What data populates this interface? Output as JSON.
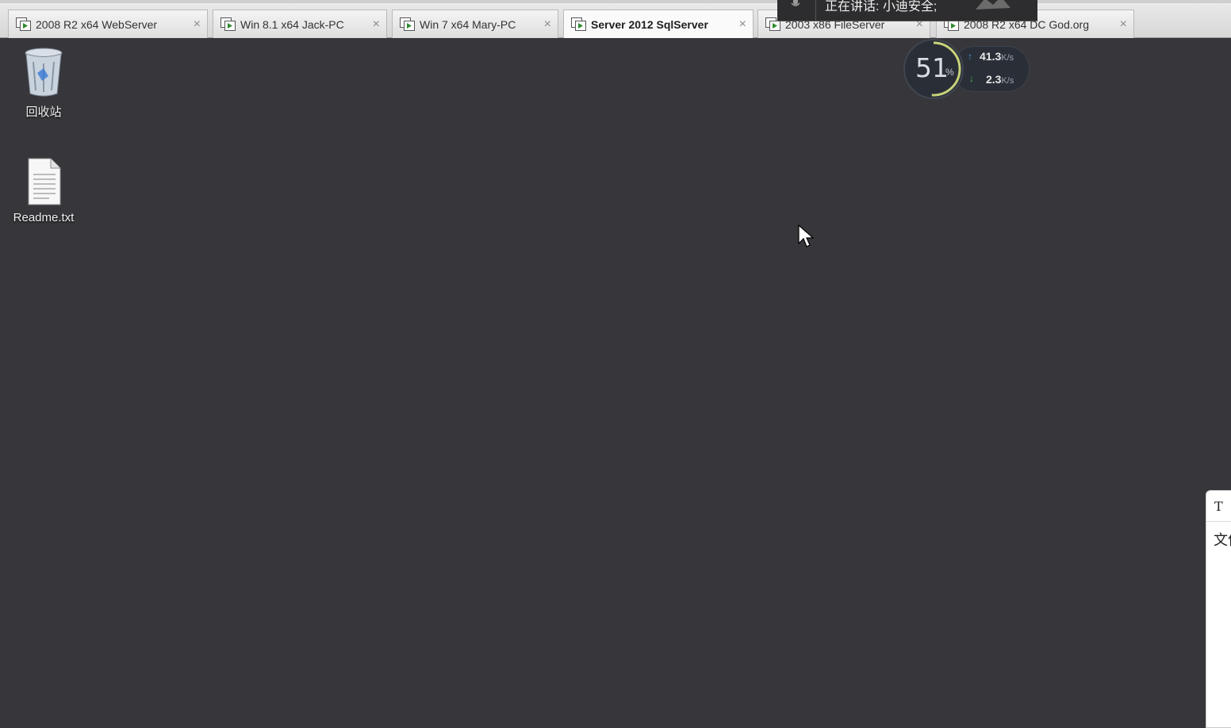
{
  "tabs": [
    {
      "label": "2008 R2 x64 WebServer",
      "active": false
    },
    {
      "label": "Win 8.1 x64 Jack-PC",
      "active": false
    },
    {
      "label": "Win 7 x64 Mary-PC",
      "active": false
    },
    {
      "label": "Server 2012 SqlServer",
      "active": true
    },
    {
      "label": "2003 x86 FileServer",
      "active": false
    },
    {
      "label": "2008 R2 x64 DC God.org",
      "active": false
    }
  ],
  "close_glyph": "×",
  "notification": {
    "text": "正在讲话: 小迪安全;",
    "icon": "microphone-icon"
  },
  "desktop": {
    "recycle_bin": {
      "label": "回收站",
      "icon": "recycle-bin-icon"
    },
    "readme": {
      "label": "Readme.txt",
      "icon": "text-file-icon"
    }
  },
  "speed_widget": {
    "percent": "51",
    "percent_unit": "%",
    "upload": "41.3",
    "download": "2.3",
    "unit": "K/s",
    "ring_color": "#c8d27a"
  },
  "side_panel": {
    "line1": "T",
    "line2": "文件"
  },
  "colors": {
    "desktop_bg": "#37363a",
    "tabbar_bg": "#e0e0e0",
    "upload_arrow": "#4a90e2",
    "download_arrow": "#4caf50"
  }
}
